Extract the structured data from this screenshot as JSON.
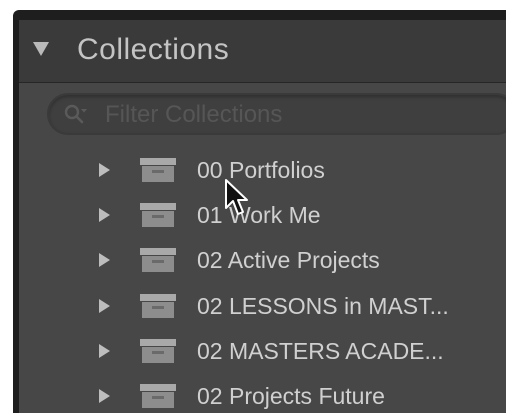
{
  "panel": {
    "title": "Collections"
  },
  "filter": {
    "placeholder": "Filter Collections"
  },
  "collections": [
    {
      "label": "00 Portfolios"
    },
    {
      "label": "01 Work Me"
    },
    {
      "label": "02 Active Projects"
    },
    {
      "label": "02 LESSONS in MAST..."
    },
    {
      "label": "02 MASTERS ACADE..."
    },
    {
      "label": "02 Projects Future"
    }
  ],
  "icons": {
    "panel_toggle": "triangle-down-icon",
    "search": "search-icon",
    "row_toggle": "triangle-right-icon",
    "collection_set": "collection-set-box-icon",
    "cursor": "mouse-pointer-icon"
  },
  "colors": {
    "panel_header": "#3a3a3a",
    "panel_body": "#474747",
    "text": "#d0d0d0",
    "title": "#c4c4c4"
  }
}
